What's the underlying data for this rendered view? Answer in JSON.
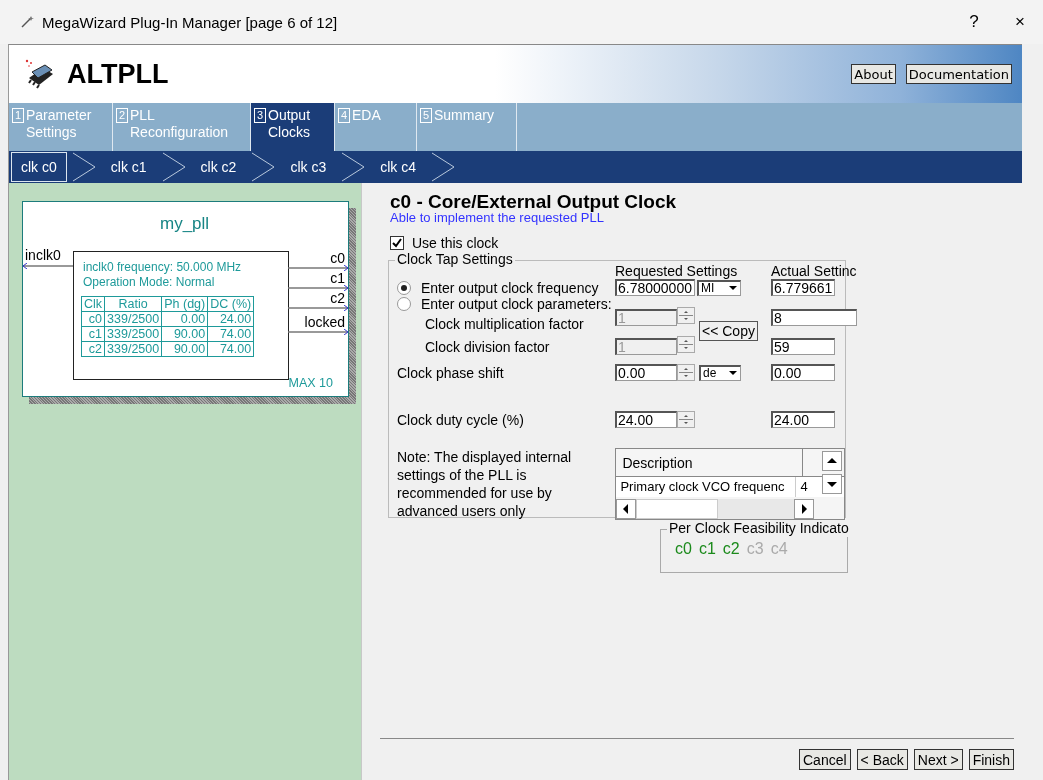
{
  "window": {
    "title": "MegaWizard Plug-In Manager [page 6 of 12]",
    "help": "?",
    "close": "×"
  },
  "header": {
    "title": "ALTPLL",
    "buttons": [
      "About",
      "Documentation"
    ]
  },
  "tabs": [
    {
      "number": "1",
      "label": "Parameter Settings",
      "selected": false
    },
    {
      "number": "2",
      "label": "PLL Reconfiguration",
      "selected": false
    },
    {
      "number": "3",
      "label": "Output Clocks",
      "selected": true
    },
    {
      "number": "4",
      "label": "EDA",
      "selected": false
    },
    {
      "number": "5",
      "label": "Summary",
      "selected": false
    }
  ],
  "clock_tabs": [
    {
      "label": "clk c0",
      "selected": true
    },
    {
      "label": "clk c1",
      "selected": false
    },
    {
      "label": "clk c2",
      "selected": false
    },
    {
      "label": "clk c3",
      "selected": false
    },
    {
      "label": "clk c4",
      "selected": false
    }
  ],
  "diagram": {
    "name": "my_pll",
    "input": "inclk0",
    "outputs": [
      "c0",
      "c1",
      "c2",
      "locked"
    ],
    "info": [
      "inclk0 frequency: 50.000 MHz",
      "Operation Mode: Normal"
    ],
    "table": {
      "columns": [
        "Clk",
        "Ratio",
        "Ph (dg)",
        "DC (%)"
      ],
      "rows": [
        [
          "c0",
          "339/2500",
          "0.00",
          "24.00"
        ],
        [
          "c1",
          "339/2500",
          "90.00",
          "74.00"
        ],
        [
          "c2",
          "339/2500",
          "90.00",
          "74.00"
        ]
      ]
    },
    "device": "MAX 10"
  },
  "panel": {
    "title": "c0 - Core/External Output Clock",
    "status": "Able to implement the requested PLL",
    "use_clock": {
      "label": "Use this clock",
      "checked": true
    },
    "group": {
      "title": "Clock Tap Settings",
      "columns": [
        "Requested Settings",
        "Actual Settinc"
      ],
      "modes": [
        {
          "label": "Enter output clock frequency",
          "selected": true
        },
        {
          "label": "Enter output clock parameters:",
          "selected": false
        }
      ],
      "frequency": {
        "value": "6.78000000",
        "unit": "MI",
        "actual": "6.779661"
      },
      "factors": [
        {
          "label": "Clock multiplication factor",
          "value": "1",
          "disabled": true,
          "actual": "8"
        },
        {
          "label": "Clock division factor",
          "value": "1",
          "disabled": true,
          "actual": "59"
        }
      ],
      "copy_button": "<< Copy",
      "phase": {
        "label": "Clock phase shift",
        "value": "0.00",
        "unit": "de",
        "actual": "0.00"
      },
      "duty": {
        "label": "Clock duty cycle (%)",
        "value": "24.00",
        "actual": "24.00"
      },
      "note": "Note: The displayed internal settings of the PLL is recommended for use by advanced users only",
      "details": {
        "columns": [
          "Description"
        ],
        "rows": [
          [
            "Primary clock VCO frequenc",
            "4"
          ]
        ]
      }
    },
    "feasibility": {
      "title": "Per Clock Feasibility Indicato",
      "clocks": [
        {
          "label": "c0",
          "feasible": true
        },
        {
          "label": "c1",
          "feasible": true
        },
        {
          "label": "c2",
          "feasible": true
        },
        {
          "label": "c3",
          "feasible": false
        },
        {
          "label": "c4",
          "feasible": false
        }
      ]
    }
  },
  "footer": {
    "buttons": [
      "Cancel",
      "< Back",
      "Next >",
      "Finish"
    ]
  }
}
